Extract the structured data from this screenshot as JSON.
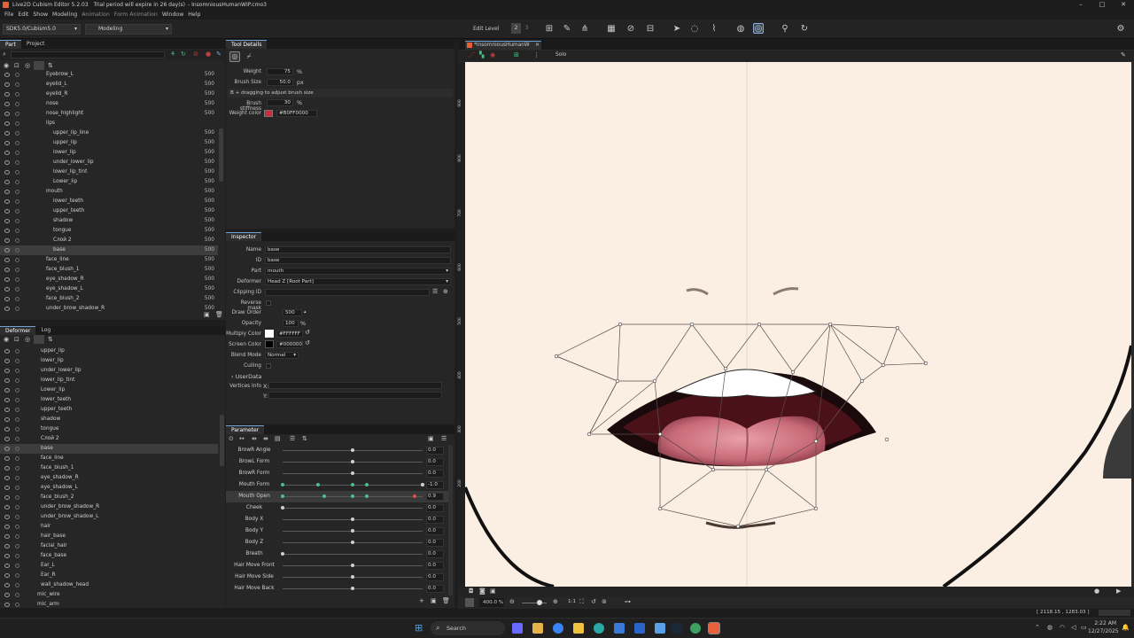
{
  "window": {
    "title": "Live2D Cubism Editor 5.2.03",
    "trial": "Trial period will expire in 26 day(s)",
    "file": "- InsomniousHumanWIP.cmo3"
  },
  "menu": [
    "File",
    "Edit",
    "Show",
    "Modeling",
    "Animation",
    "Form Animation",
    "Window",
    "Help"
  ],
  "toolbar": {
    "sdk": "SDK5.0/Cubism5.0",
    "mode": "Modeling",
    "edit_level_label": "Edit Level",
    "edit_level_values": [
      "2",
      "3"
    ]
  },
  "part_panel": {
    "tabs": [
      "Part",
      "Project"
    ],
    "rows": [
      {
        "label": "Eyebrow_L",
        "num": "500",
        "indent": 52
      },
      {
        "label": "eyelid_L",
        "num": "500",
        "indent": 52
      },
      {
        "label": "eyelid_R",
        "num": "500",
        "indent": 52
      },
      {
        "label": "nose",
        "num": "500",
        "indent": 52
      },
      {
        "label": "nose_highlight",
        "num": "500",
        "indent": 52
      },
      {
        "label": "lips",
        "num": "",
        "indent": 52
      },
      {
        "label": "upper_lip_line",
        "num": "500",
        "indent": 60
      },
      {
        "label": "upper_lip",
        "num": "500",
        "indent": 60
      },
      {
        "label": "lower_lip",
        "num": "500",
        "indent": 60
      },
      {
        "label": "under_lower_lip",
        "num": "500",
        "indent": 60
      },
      {
        "label": "lower_lip_tint",
        "num": "500",
        "indent": 60
      },
      {
        "label": "Lower_lip",
        "num": "500",
        "indent": 60
      },
      {
        "label": "mouth",
        "num": "500",
        "indent": 52
      },
      {
        "label": "lower_teeth",
        "num": "500",
        "indent": 60
      },
      {
        "label": "upper_teeth",
        "num": "500",
        "indent": 60
      },
      {
        "label": "shadow",
        "num": "500",
        "indent": 60
      },
      {
        "label": "tongue",
        "num": "500",
        "indent": 60
      },
      {
        "label": "Слой 2",
        "num": "500",
        "indent": 60
      },
      {
        "label": "base",
        "num": "500",
        "indent": 60,
        "selected": true
      },
      {
        "label": "face_line",
        "num": "500",
        "indent": 52
      },
      {
        "label": "face_blush_1",
        "num": "500",
        "indent": 52
      },
      {
        "label": "eye_shadow_R",
        "num": "500",
        "indent": 52
      },
      {
        "label": "eye_shadow_L",
        "num": "500",
        "indent": 52
      },
      {
        "label": "face_blush_2",
        "num": "500",
        "indent": 52
      },
      {
        "label": "under_brow_shadow_R",
        "num": "500",
        "indent": 52
      }
    ]
  },
  "deformer_panel": {
    "tabs": [
      "Deformer",
      "Log"
    ],
    "rows": [
      {
        "label": "upper_lip",
        "indent": 46
      },
      {
        "label": "lower_lip",
        "indent": 46
      },
      {
        "label": "under_lower_lip",
        "indent": 46
      },
      {
        "label": "lower_lip_tint",
        "indent": 46
      },
      {
        "label": "Lower_lip",
        "indent": 46
      },
      {
        "label": "lower_teeth",
        "indent": 46
      },
      {
        "label": "upper_teeth",
        "indent": 46
      },
      {
        "label": "shadow",
        "indent": 46
      },
      {
        "label": "tongue",
        "indent": 46
      },
      {
        "label": "Слой 2",
        "indent": 46
      },
      {
        "label": "base",
        "indent": 46,
        "selected": true
      },
      {
        "label": "face_line",
        "indent": 46
      },
      {
        "label": "face_blush_1",
        "indent": 46
      },
      {
        "label": "eye_shadow_R",
        "indent": 46
      },
      {
        "label": "eye_shadow_L",
        "indent": 46
      },
      {
        "label": "face_blush_2",
        "indent": 46
      },
      {
        "label": "under_brow_shadow_R",
        "indent": 46
      },
      {
        "label": "under_brow_shadow_L",
        "indent": 46
      },
      {
        "label": "hair",
        "indent": 46
      },
      {
        "label": "hair_base",
        "indent": 46
      },
      {
        "label": "facial_hair",
        "indent": 46
      },
      {
        "label": "face_base",
        "indent": 46
      },
      {
        "label": "Ear_L",
        "indent": 46
      },
      {
        "label": "Ear_R",
        "indent": 46
      },
      {
        "label": "wall_shadow_head",
        "indent": 46
      },
      {
        "label": "mic_wire",
        "indent": 42
      },
      {
        "label": "mic_arm",
        "indent": 42
      }
    ]
  },
  "tool_details": {
    "title": "Tool Details",
    "weight_label": "Weight",
    "weight": "75",
    "weight_unit": "%",
    "brush_label": "Brush Size",
    "brush": "50.0",
    "brush_unit": "px",
    "hint": "B + dragging to adjust brush size",
    "stiff_label": "Brush stiffness",
    "stiff": "30",
    "stiff_unit": "%",
    "color_label": "Weight color",
    "color_value": "#B0FF0000"
  },
  "inspector": {
    "title": "Inspector",
    "name_label": "Name",
    "name": "base",
    "id_label": "ID",
    "id": "base",
    "part_label": "Part",
    "part": "mouth",
    "deformer_label": "Deformer",
    "deformer": "Head Z  [Root Part]",
    "clip_label": "Clipping ID",
    "reverse_label": "Reverse mask",
    "draw_label": "Draw Order",
    "draw": "500",
    "opacity_label": "Opacity",
    "opacity": "100",
    "opacity_unit": "%",
    "mult_label": "Multiply Color",
    "mult": "#FFFFFF",
    "screen_label": "Screen Color",
    "screen": "#000000",
    "blend_label": "Blend Mode",
    "blend": "Normal",
    "culling_label": "Culling",
    "userdata_label": "UserData",
    "vert_label": "Vertices Info",
    "x_label": "X:",
    "y_label": "Y:"
  },
  "parameter": {
    "title": "Parameter",
    "rows": [
      {
        "name": "BrowR Angle",
        "value": "0.0",
        "knob": 0.5,
        "keys": []
      },
      {
        "name": "BrowL Form",
        "value": "0.0",
        "knob": 0.5,
        "keys": []
      },
      {
        "name": "BrowR Form",
        "value": "0.0",
        "knob": 0.5,
        "keys": []
      },
      {
        "name": "Mouth Form",
        "value": "-1.0",
        "knob": 1.0,
        "keys": [
          0,
          0.25,
          0.5,
          0.6,
          1.0
        ]
      },
      {
        "name": "Mouth Open",
        "value": "0.9",
        "knob": 0.94,
        "keys": [
          0,
          0.3,
          0.5,
          0.6
        ],
        "selected": true
      },
      {
        "name": "Cheek",
        "value": "0.0",
        "knob": 0.0,
        "keys": []
      },
      {
        "name": "Body X",
        "value": "0.0",
        "knob": 0.5,
        "keys": []
      },
      {
        "name": "Body Y",
        "value": "0.0",
        "knob": 0.5,
        "keys": []
      },
      {
        "name": "Body Z",
        "value": "0.0",
        "knob": 0.5,
        "keys": []
      },
      {
        "name": "Breath",
        "value": "0.0",
        "knob": 0.0,
        "keys": []
      },
      {
        "name": "Hair Move Front",
        "value": "0.0",
        "knob": 0.5,
        "keys": []
      },
      {
        "name": "Hair Move Side",
        "value": "0.0",
        "knob": 0.5,
        "keys": []
      },
      {
        "name": "Hair Move Back",
        "value": "0.0",
        "knob": 0.5,
        "keys": []
      }
    ]
  },
  "viewport": {
    "tab": "*InsomniousHumanW",
    "solo": "Solo",
    "ruler": [
      "900",
      "800",
      "700",
      "600",
      "500",
      "400",
      "300",
      "200"
    ],
    "zoom": "400.0",
    "zoom_unit": "%",
    "ratio": "1:1"
  },
  "status": {
    "coords": "[ 2118.15 , 1283.03 ]"
  },
  "taskbar": {
    "search": "Search",
    "time": "2:22 AM",
    "date": "12/27/2025",
    "colors": {
      "accent": "#4aa0e6",
      "key": "#49c08a",
      "selection": "#3d3d3d"
    }
  }
}
